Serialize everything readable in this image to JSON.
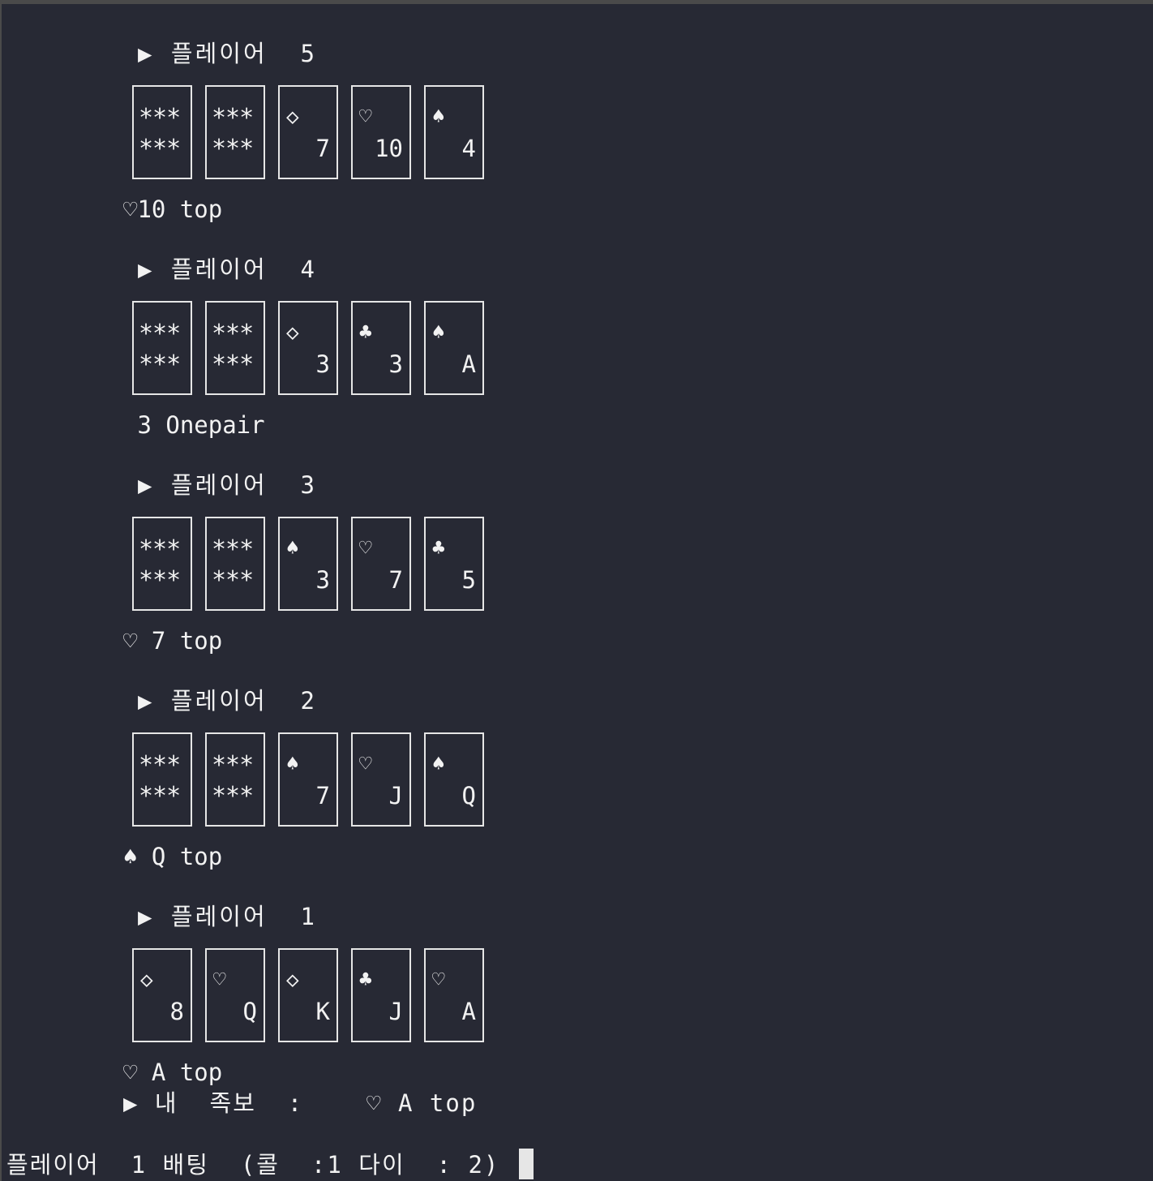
{
  "players": [
    {
      "header": "▶ 플레이어  5",
      "cards": [
        {
          "hidden": true
        },
        {
          "hidden": true
        },
        {
          "suit": "◇",
          "rank": "7"
        },
        {
          "suit": "♡",
          "rank": "10"
        },
        {
          "suit": "♠",
          "rank": "4"
        }
      ],
      "hand": "♡10 top"
    },
    {
      "header": "▶ 플레이어  4",
      "cards": [
        {
          "hidden": true
        },
        {
          "hidden": true
        },
        {
          "suit": "◇",
          "rank": "3"
        },
        {
          "suit": "♣",
          "rank": "3"
        },
        {
          "suit": "♠",
          "rank": "A"
        }
      ],
      "hand": " 3 Onepair"
    },
    {
      "header": "▶ 플레이어  3",
      "cards": [
        {
          "hidden": true
        },
        {
          "hidden": true
        },
        {
          "suit": "♠",
          "rank": "3"
        },
        {
          "suit": "♡",
          "rank": "7"
        },
        {
          "suit": "♣",
          "rank": "5"
        }
      ],
      "hand": "♡ 7 top"
    },
    {
      "header": "▶ 플레이어  2",
      "cards": [
        {
          "hidden": true
        },
        {
          "hidden": true
        },
        {
          "suit": "♠",
          "rank": "7"
        },
        {
          "suit": "♡",
          "rank": "J"
        },
        {
          "suit": "♠",
          "rank": "Q"
        }
      ],
      "hand": "♠ Q top"
    },
    {
      "header": "▶ 플레이어  1",
      "cards": [
        {
          "suit": "◇",
          "rank": "8"
        },
        {
          "suit": "♡",
          "rank": "Q"
        },
        {
          "suit": "◇",
          "rank": "K"
        },
        {
          "suit": "♣",
          "rank": "J"
        },
        {
          "suit": "♡",
          "rank": "A"
        }
      ],
      "hand": "♡ A top"
    }
  ],
  "hidden_card_text": "***\n***",
  "my_hand": "▶ 내  족보  :    ♡ A top",
  "bet_prompt": "플레이어  1 배팅  (콜  :1 다이  : 2)",
  "colors": {
    "background": "#272934",
    "text": "#f2f2f2",
    "card_border": "#e6e6e6"
  }
}
